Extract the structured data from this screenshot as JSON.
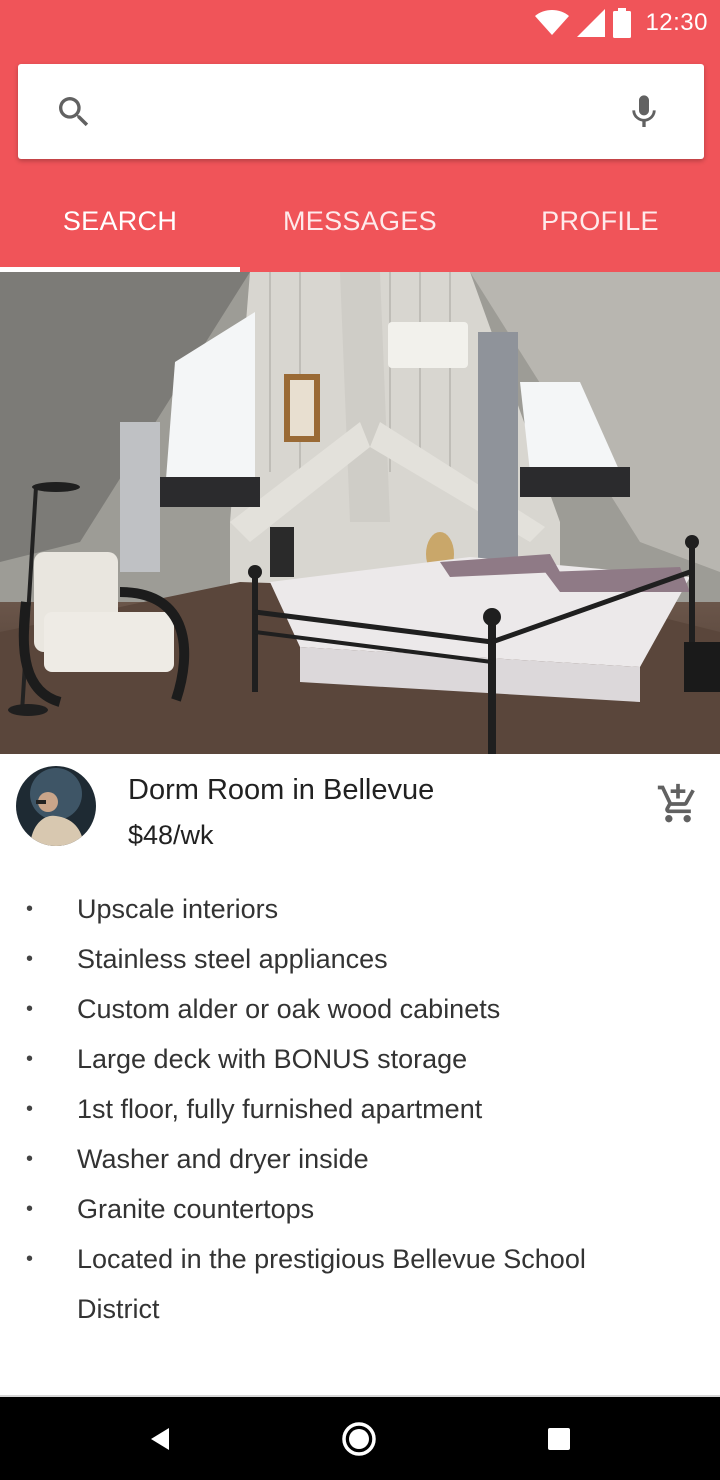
{
  "status_bar": {
    "time": "12:30",
    "icons": [
      "wifi-icon",
      "signal-icon",
      "battery-icon"
    ]
  },
  "search": {
    "value": "",
    "placeholder": "",
    "icon": "search-icon",
    "mic_icon": "mic-icon"
  },
  "tabs": [
    {
      "label": "SEARCH",
      "selected": true
    },
    {
      "label": "MESSAGES",
      "selected": false
    },
    {
      "label": "PROFILE",
      "selected": false
    }
  ],
  "listing": {
    "title": "Dorm Room in Bellevue",
    "price": "$48/wk",
    "action_icon": "add-to-cart-icon",
    "features": [
      "Upscale interiors",
      "Stainless steel appliances",
      "Custom alder or oak wood cabinets",
      "Large deck with BONUS storage",
      "1st floor, fully furnished apartment",
      "Washer and dryer inside",
      "Granite countertops",
      "Located in the prestigious Bellevue School District"
    ]
  },
  "nav_bar": {
    "buttons": [
      "back-icon",
      "home-icon",
      "recents-icon"
    ]
  },
  "colors": {
    "accent": "#f05459",
    "tab_text": "#ffffff",
    "text": "#212121",
    "navbar": "#000000"
  }
}
